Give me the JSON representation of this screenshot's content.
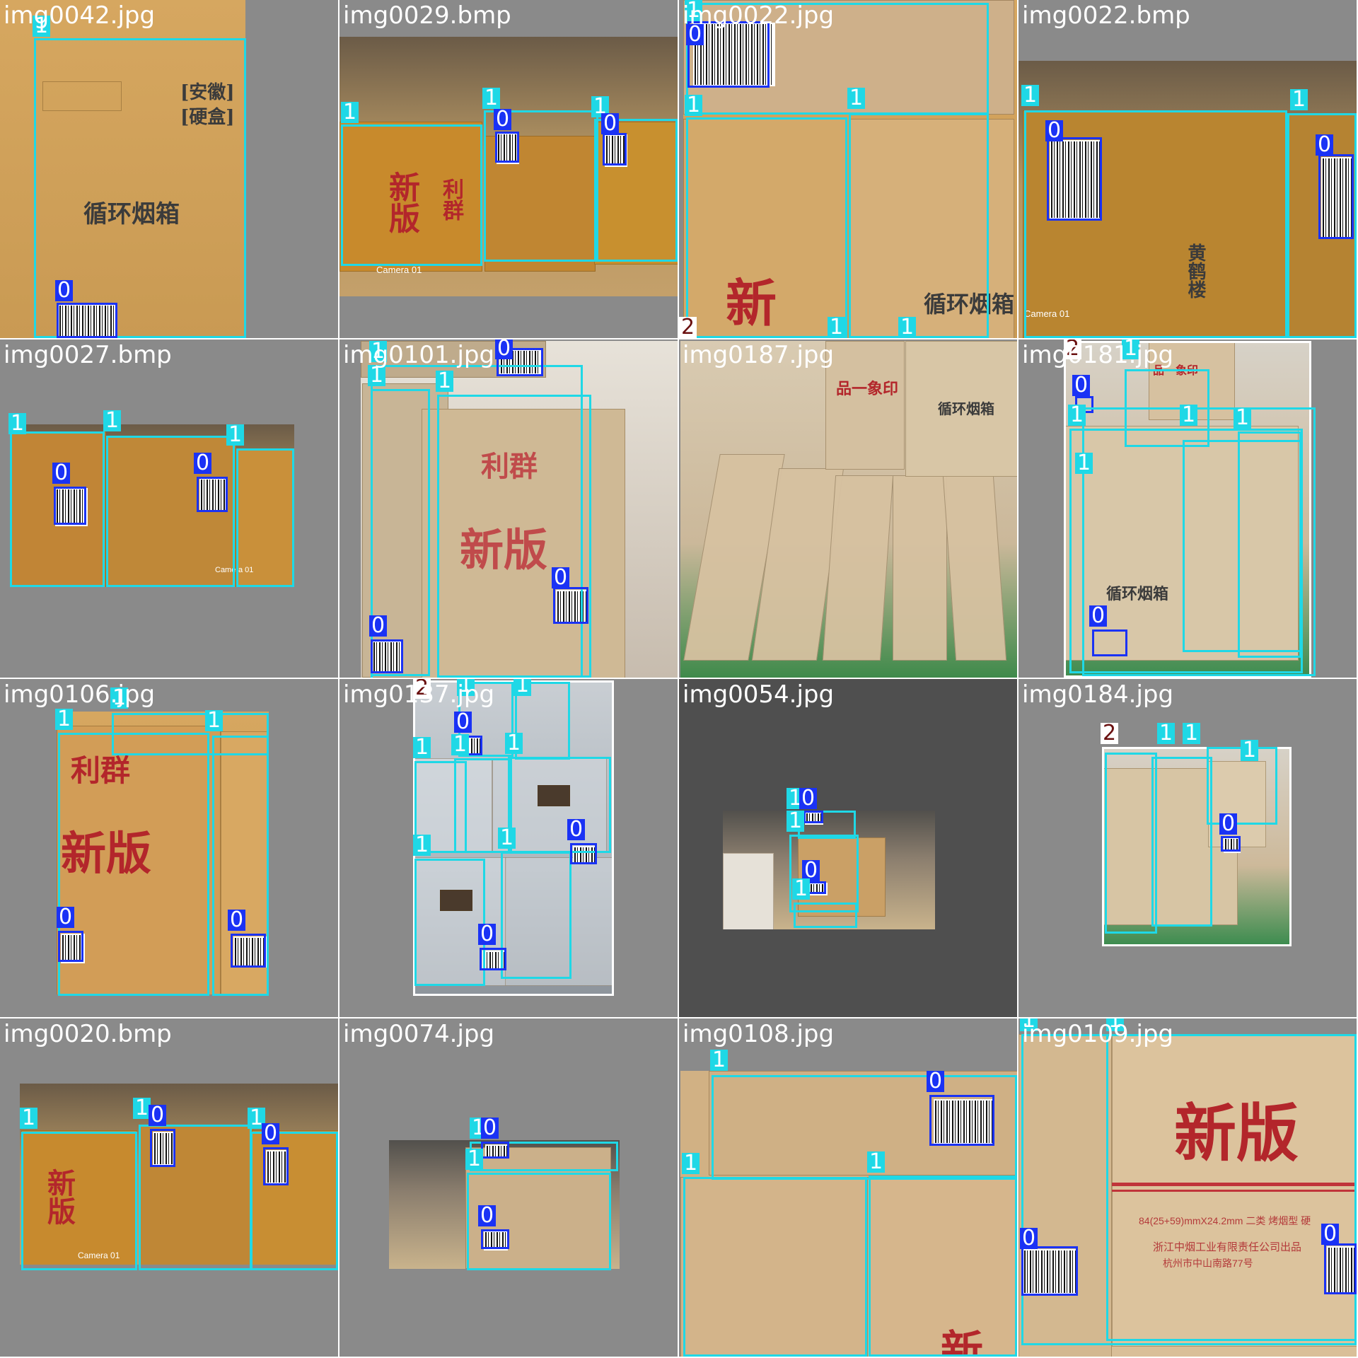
{
  "grid": {
    "tiles": [
      {
        "filename": "img0042.jpg",
        "labels": [
          "1",
          "0"
        ],
        "photo_text": [
          "[安徽]",
          "[硬盒]",
          "循环烟箱"
        ]
      },
      {
        "filename": "img0029.bmp",
        "labels": [
          "1",
          "1",
          "1",
          "0",
          "0"
        ],
        "photo_text": [
          "新版",
          "利群",
          "Camera 01"
        ]
      },
      {
        "filename": "img0022.jpg",
        "labels": [
          "1",
          "0",
          "1",
          "1",
          "2",
          "1",
          "1"
        ],
        "photo_text": [
          "新",
          "循环烟箱"
        ]
      },
      {
        "filename": "img0022.bmp",
        "labels": [
          "1",
          "0",
          "1",
          "0"
        ],
        "photo_text": [
          "黄鹤楼",
          "Camera 01"
        ]
      },
      {
        "filename": "img0027.bmp",
        "labels": [
          "1",
          "1",
          "1",
          "0",
          "0"
        ],
        "photo_text": [
          "Camera 01"
        ]
      },
      {
        "filename": "img0101.jpg",
        "labels": [
          "1",
          "0",
          "1",
          "1",
          "0",
          "0"
        ],
        "photo_text": [
          "新版",
          "利群"
        ]
      },
      {
        "filename": "img0187.jpg",
        "labels": [],
        "photo_text": [
          "品一象印",
          "循环烟箱"
        ]
      },
      {
        "filename": "img0181.jpg",
        "labels": [
          "2",
          "1",
          "1",
          "0",
          "1",
          "1",
          "1",
          "0"
        ],
        "photo_text": [
          "品一象印",
          "循环烟箱"
        ]
      },
      {
        "filename": "img0106.jpg",
        "labels": [
          "1",
          "1",
          "1",
          "0",
          "0"
        ],
        "photo_text": [
          "新版",
          "利群"
        ]
      },
      {
        "filename": "img0137.jpg",
        "labels": [
          "2",
          "1",
          "1",
          "0",
          "1",
          "1",
          "1",
          "1",
          "1",
          "0",
          "0"
        ],
        "photo_text": []
      },
      {
        "filename": "img0054.jpg",
        "labels": [
          "1",
          "0",
          "1",
          "0",
          "1"
        ],
        "photo_text": []
      },
      {
        "filename": "img0184.jpg",
        "labels": [
          "2",
          "1",
          "1",
          "1",
          "0"
        ],
        "photo_text": []
      },
      {
        "filename": "img0020.bmp",
        "labels": [
          "1",
          "1",
          "0",
          "1",
          "0"
        ],
        "photo_text": [
          "新版",
          "Camera 01"
        ]
      },
      {
        "filename": "img0074.jpg",
        "labels": [
          "1",
          "0",
          "1",
          "0"
        ],
        "photo_text": []
      },
      {
        "filename": "img0108.jpg",
        "labels": [
          "1",
          "0",
          "1",
          "1"
        ],
        "photo_text": [
          "新"
        ]
      },
      {
        "filename": "img0109.jpg",
        "labels": [
          "1",
          "1",
          "0",
          "0"
        ],
        "photo_text": [
          "新版",
          "84(25+59)mmX24.2mm 二类 烤烟型 硬",
          "浙江中烟工业有限责任公司出品",
          "杭州市中山南路77号"
        ]
      }
    ]
  },
  "colors": {
    "class0": "#1a32f5",
    "class1": "#1fd8e6",
    "class2": "#ffffff",
    "tile_bg": "#8a8a8a"
  }
}
